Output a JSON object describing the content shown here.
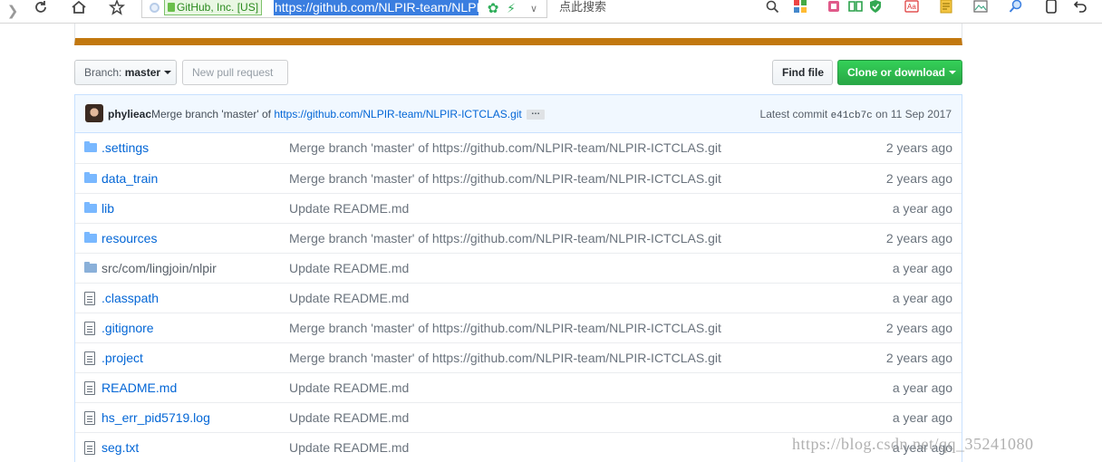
{
  "browser": {
    "ev_label": "GitHub, Inc. [US]",
    "url_selected": "https://github.com/NLPIR-team/NLPIR-ICTCLAS",
    "search_placeholder": "点此搜索",
    "icons": [
      "forward-icon",
      "reload-icon",
      "home-icon",
      "star-icon",
      "security-icon",
      "ev-lock-icon",
      "refresh-speed-icon",
      "lightning-icon",
      "dropdown-icon",
      "search-icon",
      "apps-icon",
      "bookmark-icon",
      "reader-icon",
      "shield-icon",
      "translate-icon",
      "notes-icon",
      "image-icon",
      "magnifier-icon",
      "mobile-icon",
      "undo-icon"
    ]
  },
  "repo": {
    "branch_label": "Branch:",
    "branch_name": "master",
    "new_pr": "New pull request",
    "find_file": "Find file",
    "clone": "Clone or download"
  },
  "commit": {
    "author": "phylieac",
    "message_prefix": "Merge branch 'master' of",
    "message_link": "https://github.com/NLPIR-team/NLPIR-ICTCLAS.git",
    "ellipsis": "…",
    "latest_label": "Latest commit",
    "sha": "e41cb7c",
    "date": "on 11 Sep 2017"
  },
  "files": [
    {
      "type": "dir",
      "name": ".settings",
      "message": "Merge branch 'master' of https://github.com/NLPIR-team/NLPIR-ICTCLAS.git",
      "age": "2 years ago"
    },
    {
      "type": "dir",
      "name": "data_train",
      "message": "Merge branch 'master' of https://github.com/NLPIR-team/NLPIR-ICTCLAS.git",
      "age": "2 years ago"
    },
    {
      "type": "dir",
      "name": "lib",
      "message": "Update README.md",
      "age": "a year ago"
    },
    {
      "type": "dir",
      "name": "resources",
      "message": "Merge branch 'master' of https://github.com/NLPIR-team/NLPIR-ICTCLAS.git",
      "age": "2 years ago"
    },
    {
      "type": "dir-plain",
      "name": "src/com/lingjoin/nlpir",
      "message": "Update README.md",
      "age": "a year ago"
    },
    {
      "type": "file",
      "name": ".classpath",
      "message": "Update README.md",
      "age": "a year ago"
    },
    {
      "type": "file",
      "name": ".gitignore",
      "message": "Merge branch 'master' of https://github.com/NLPIR-team/NLPIR-ICTCLAS.git",
      "age": "2 years ago"
    },
    {
      "type": "file",
      "name": ".project",
      "message": "Merge branch 'master' of https://github.com/NLPIR-team/NLPIR-ICTCLAS.git",
      "age": "2 years ago"
    },
    {
      "type": "file",
      "name": "README.md",
      "message": "Update README.md",
      "age": "a year ago"
    },
    {
      "type": "file",
      "name": "hs_err_pid5719.log",
      "message": "Update README.md",
      "age": "a year ago"
    },
    {
      "type": "file",
      "name": "seg.txt",
      "message": "Update README.md",
      "age": "a year ago"
    }
  ],
  "watermark": "https://blog.csdn.net/qq_35241080"
}
